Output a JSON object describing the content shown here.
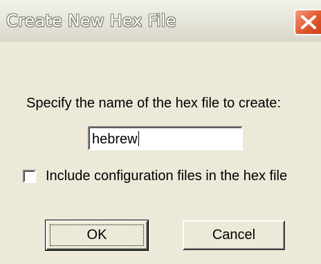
{
  "window": {
    "title": "Create New Hex File",
    "close_icon": "close-icon"
  },
  "form": {
    "prompt": "Specify the name of the hex file to create:",
    "filename_value": "hebrew",
    "include_config_label": "Include configuration files in the hex file",
    "include_config_checked": false
  },
  "buttons": {
    "ok_label": "OK",
    "cancel_label": "Cancel"
  },
  "colors": {
    "dialog_background": "#ece9d8",
    "close_button": "#e2592c"
  }
}
